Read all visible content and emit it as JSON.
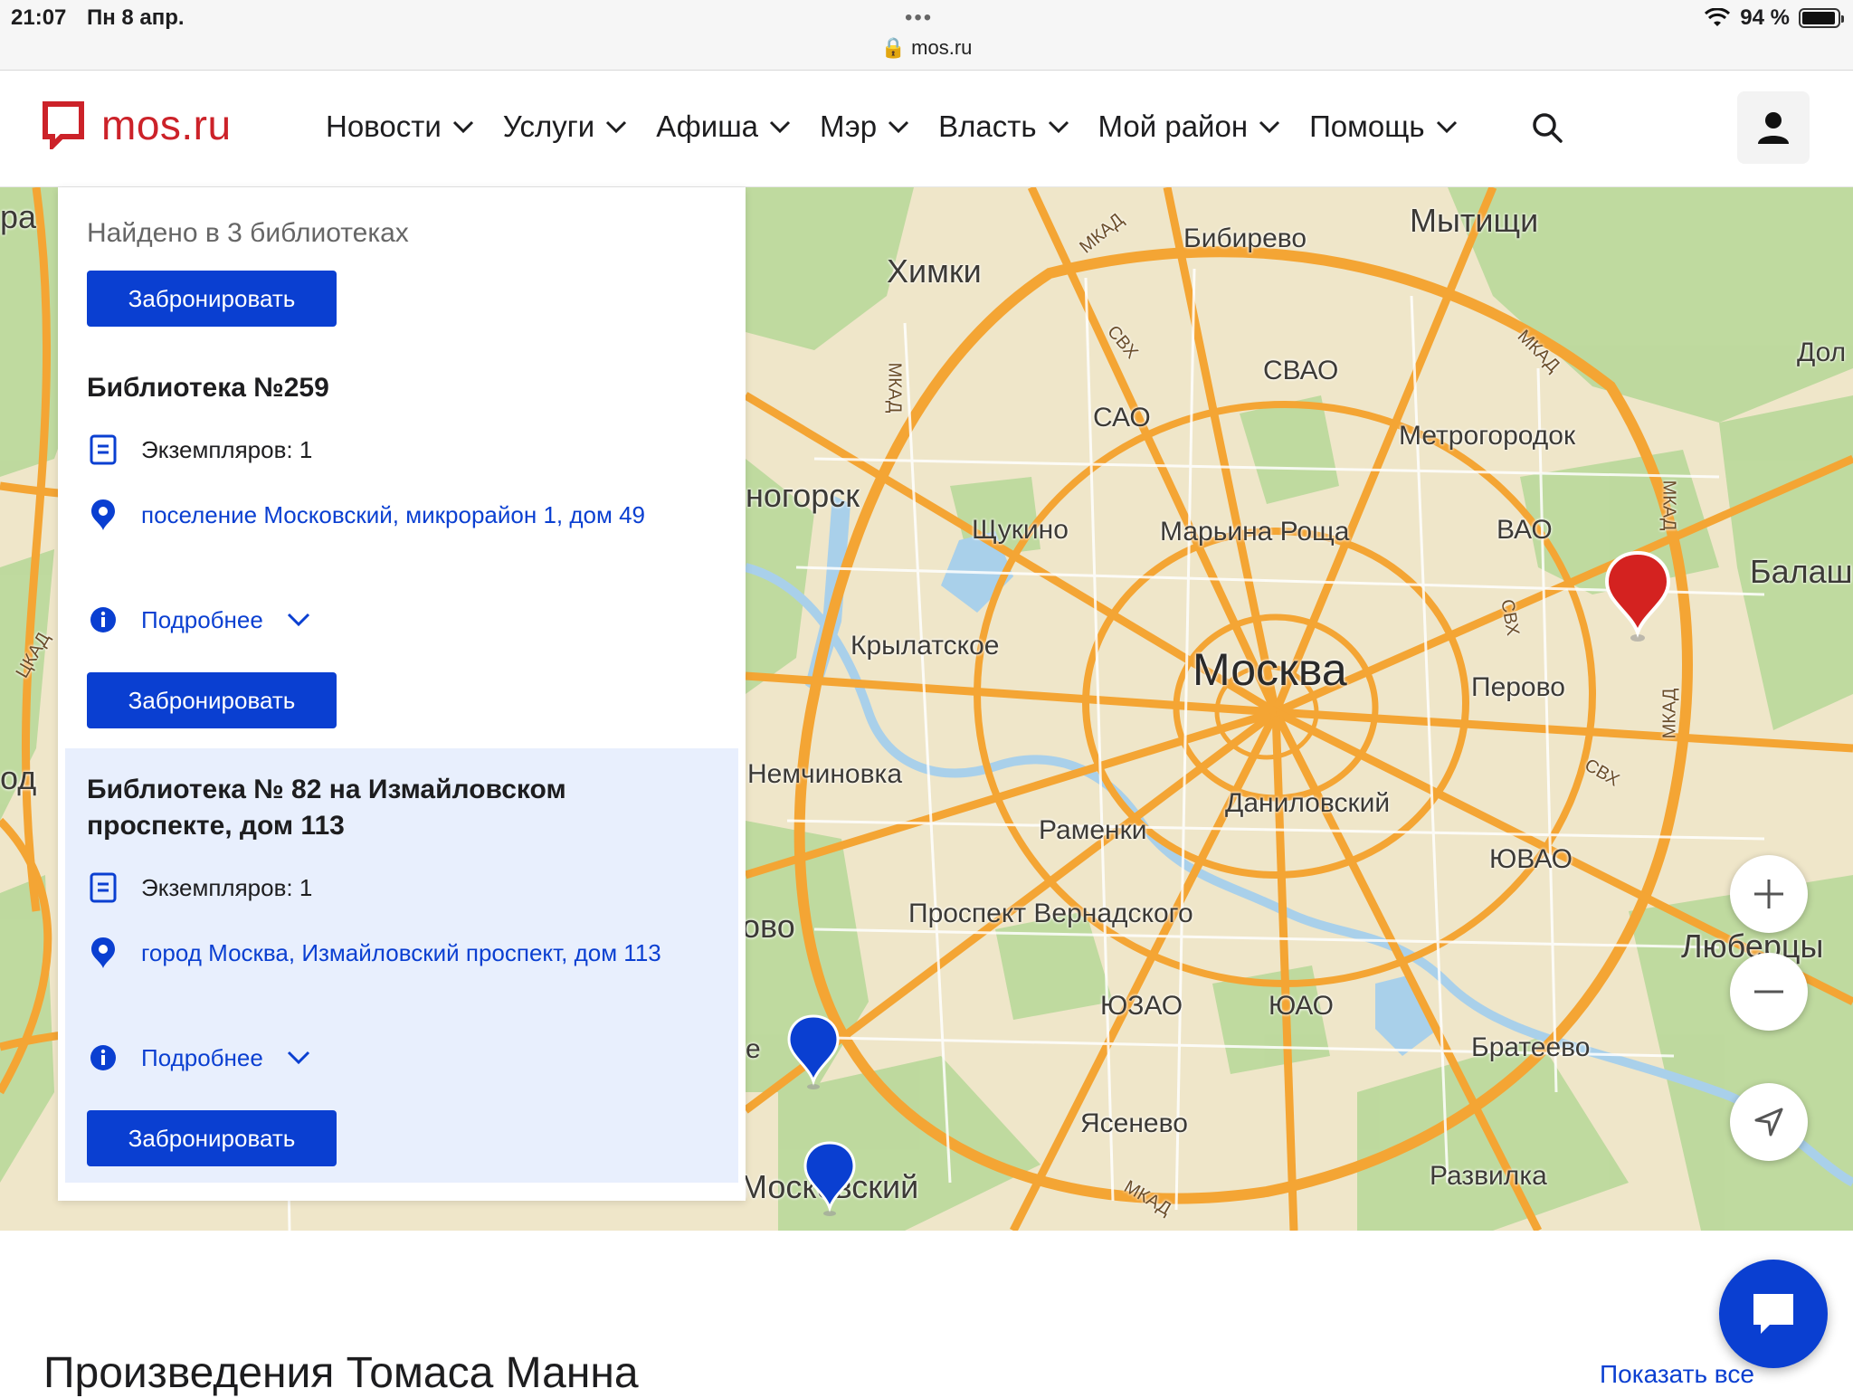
{
  "status_bar": {
    "time": "21:07",
    "date": "Пн 8 апр.",
    "url": "mos.ru",
    "battery": "94 %",
    "battery_level": 0.94
  },
  "header": {
    "logo_text": "mos.ru",
    "nav": [
      {
        "label": "Новости"
      },
      {
        "label": "Услуги"
      },
      {
        "label": "Афиша"
      },
      {
        "label": "Мэр"
      },
      {
        "label": "Власть"
      },
      {
        "label": "Мой район"
      },
      {
        "label": "Помощь"
      }
    ],
    "search_icon": "search-icon",
    "user_icon": "user-icon"
  },
  "panel": {
    "found_text": "Найдено в 3 библиотеках",
    "reserve_label": "Забронировать",
    "libraries": [
      {
        "title": "Библиотека №259",
        "copies": "Экземпляров: 1",
        "address": "поселение Московский, микрорайон 1, дом 49",
        "details": "Подробнее",
        "reserve": "Забронировать"
      },
      {
        "title": "Библиотека № 82 на Измайловском проспекте, дом 113",
        "copies": "Экземпляров: 1",
        "address": "город Москва, Измайловский проспект, дом 113",
        "details": "Подробнее",
        "reserve": "Забронировать"
      }
    ]
  },
  "map": {
    "labels": {
      "moscow": "Москва",
      "khimki": "Химки",
      "mytishchi": "Мытищи",
      "bibirevo": "Бибирево",
      "svao": "СВАО",
      "sao": "САО",
      "metrogorodok": "Метрогородок",
      "shchukino": "Щукино",
      "maryina_roshcha": "Марьина Роща",
      "vao": "ВАО",
      "balash": "Балаш",
      "krylatskoe": "Крылатское",
      "perovo": "Перово",
      "nemchinovka": "Немчиновка",
      "danilovsky": "Даниловский",
      "ramenki": "Раменки",
      "yuvao": "ЮВАО",
      "prospekt_vernadskogo": "Проспект Вернадского",
      "lyubertsy": "Люберцы",
      "yuzao": "ЮЗАО",
      "yuao": "ЮАО",
      "brateevo": "Братеево",
      "yasenevo": "Ясенево",
      "razvilka": "Развилка",
      "moskovsky": "Московский",
      "zelenogorsk": "ногорск",
      "dol": "Дол",
      "ovo": "ово",
      "ra": "ра",
      "od": "од",
      "e": "е",
      "mkad": "МКАД",
      "svh": "СВХ",
      "ckad": "ЦКАД"
    },
    "zoom_in": "+",
    "zoom_out": "−"
  },
  "bottom": {
    "section_title": "Произведения Томаса Манна",
    "show_all": "Показать все"
  }
}
